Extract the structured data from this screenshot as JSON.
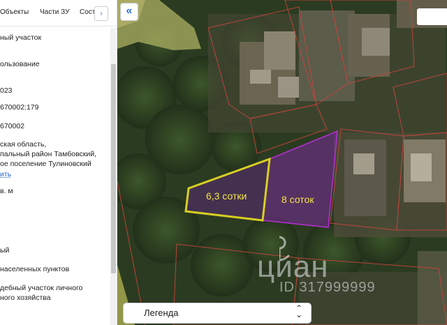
{
  "panel": {
    "tabs": [
      "Объекты",
      "Части ЗУ",
      "Соста"
    ],
    "tab_more_icon": "chevron-right-icon",
    "tab_more_glyph": "›",
    "fields": [
      "ный участок",
      "ользование",
      "023",
      "670002:179",
      "670002",
      "ская область,",
      "пальный район Тамбовский,",
      "ое поселение Тулиновский",
      "ить",
      "в. м",
      "ый",
      "населенных пунктов",
      "дебный участок личного",
      "ного хозяйства"
    ]
  },
  "map": {
    "collapse_icon": "double-chevron-left-icon",
    "collapse_glyph": "«",
    "plot_labels": [
      "6,3 сотки",
      "8 соток"
    ],
    "watermark": {
      "brand": "циан",
      "id": "ID 317999999"
    },
    "legend": {
      "label": "Легенда",
      "caret_up": "⌃",
      "caret_down": "⌄"
    },
    "colors": {
      "plot_a": "#d6cf1e",
      "plot_b": "#a321c8",
      "boundaries": "#c8453c"
    }
  }
}
